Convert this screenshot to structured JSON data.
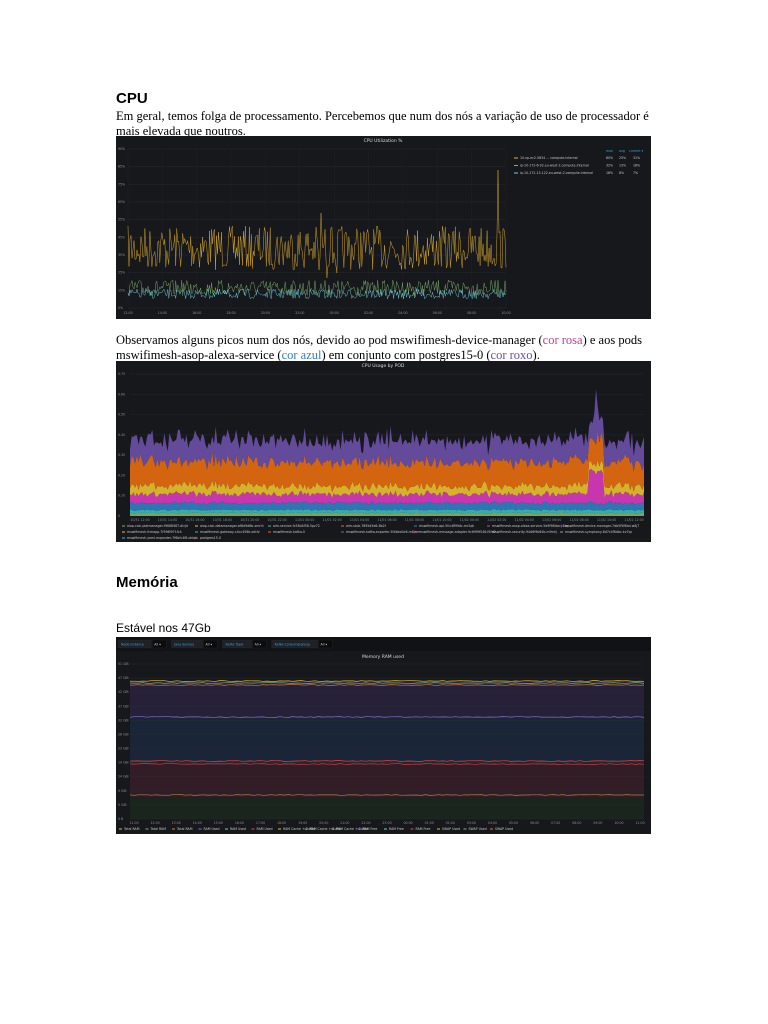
{
  "cpu": {
    "heading": "CPU",
    "text": "Em geral, temos folga de processamento. Percebemos que num dos nós a variação de uso de processador é mais elevada que noutros.",
    "panel_title": "CPU Utilization %",
    "legend_header": {
      "max": "max",
      "avg": "avg",
      "current": "current ▾"
    },
    "legend": [
      {
        "name": "10-vp-ec2-5834 ... compute.internal",
        "max": "80%",
        "avg": "25%",
        "current": "31%",
        "color": "#e5b32c"
      },
      {
        "name": "ip-10-172-6-92.eu-west-2.compute.internal",
        "max": "32%",
        "avg": "13%",
        "current": "18%",
        "color": "#7eb26d"
      },
      {
        "name": "ip-10-172-13-122.eu-west-2.compute.internal",
        "max": "18%",
        "avg": "8%",
        "current": "7%",
        "color": "#6ed0e0"
      }
    ],
    "y_ticks": [
      "90%",
      "85%",
      "75%",
      "65%",
      "55%",
      "45%",
      "35%",
      "25%",
      "15%",
      "0%"
    ],
    "x_ticks": [
      "12:00",
      "14:00",
      "16:00",
      "18:00",
      "20:00",
      "22:00",
      "00:00",
      "02:00",
      "04:00",
      "06:00",
      "08:00",
      "10:00"
    ]
  },
  "pods": {
    "text_before": "Observamos alguns picos num dos nós, devido ao pod mswifimesh-device-manager (",
    "pink_label": "cor rosa",
    "text_middle1": ") e aos pods mswifimesh-asop-alexa-service (",
    "blue_label": "cor azul",
    "text_middle2": ") em conjunto com postgres15-0 (",
    "purple_label": "cor roxo",
    "text_after": ").",
    "panel_title": "CPU Usage by POD",
    "y_ticks": [
      "0.75",
      "0.60",
      "0.50",
      "0.40",
      "0.30",
      "0.20",
      "0.10",
      "0"
    ],
    "x_ticks": [
      "10/31 12:00",
      "10/31 14:00",
      "10/31 16:00",
      "10/31 18:00",
      "10/31 20:00",
      "10/31 22:00",
      "11/01 00:00",
      "11/01 02:00",
      "11/01 04:00",
      "11/01 06:00",
      "11/01 08:00",
      "11/01 10:00",
      "11/02 00:00",
      "11/02 02:00",
      "11/02 04:00",
      "11/02 06:00",
      "11/02 08:00",
      "11/02 10:00",
      "11/02 12:00"
    ],
    "legend_row1": [
      "aiop-calc-platmanager-f9688987-dtrjd",
      "aiop-calc-datamanager-bf8d9d6b-xmrhl",
      "aim-service-fc58d4f58-5pz72",
      "aim-stub-7895d5d6-8b2f",
      "mswifimesh-api-5fcc8f99dc-mr2qk",
      "mswifimesh-asop-alexa-service-5d9f96bbc-j4bq",
      "mswifimesh-device-manager-7db5f5f6bd-w6j7"
    ],
    "legend_row2": [
      "mswifimesh-fcmapp-7f596f97f-fc4",
      "mswifimesh-gateway-c4cc456b-wfcfz",
      "mswifimesh-kafka-0",
      "mswifimesh-kafka-exporter-5f4bbd4c6-m8jmr",
      "mswifimesh-message-adapter-9c69f9f546-f4fd2",
      "mswifimesh-security-94d6f9b64b-mfmhj",
      "mswifimesh-symphony-6d7c4f8dbc-kv7qc"
    ],
    "legend_row3": [
      "mswifimesh-yaml-expander-7f6bfc4f8-ddqk",
      "postgres15-0"
    ],
    "colors": {
      "purple": "#6b4fa6",
      "orange": "#e46d0f",
      "yellow": "#e5c02c",
      "pink": "#d73ab9",
      "blue": "#2f7fc1",
      "teal": "#3fb8b3",
      "green": "#7eb26d"
    }
  },
  "memory": {
    "heading": "Memória",
    "text": "Estável nos 47Gb",
    "filters": [
      {
        "label": "Node instance",
        "value": "All ▾"
      },
      {
        "label": "Java devices",
        "value": "All ▾"
      },
      {
        "label": "Kafka Topic",
        "value": "All ▾"
      },
      {
        "label": "Kafka Consumergroup",
        "value": "All ▾"
      }
    ],
    "panel_title": "Memory RAM used",
    "y_ticks": [
      "51 GiB",
      "47 GiB",
      "42 GiB",
      "37 GiB",
      "33 GiB",
      "28 GiB",
      "23 GiB",
      "19 GiB",
      "14 GiB",
      "9 GiB",
      "5 GiB",
      "0 B"
    ],
    "x_ticks": [
      "11:00",
      "12:00",
      "13:00",
      "14:00",
      "15:00",
      "16:00",
      "17:00",
      "18:00",
      "19:00",
      "20:00",
      "21:00",
      "22:00",
      "23:00",
      "00:00",
      "01:00",
      "02:00",
      "03:00",
      "04:00",
      "05:00",
      "06:00",
      "07:00",
      "08:00",
      "09:00",
      "10:00",
      "11:00"
    ],
    "legend": [
      "Total RAM",
      "Total RAM",
      "Total RAM",
      "RAM Used",
      "RAM Used",
      "RAM Used",
      "RAM Cache + Buffer",
      "RAM Cache + Buffer",
      "RAM Cache + Buffer",
      "RAM Free",
      "RAM Free",
      "RAM Free",
      "SWAP Used",
      "SWAP Used",
      "SWAP Used"
    ]
  }
}
